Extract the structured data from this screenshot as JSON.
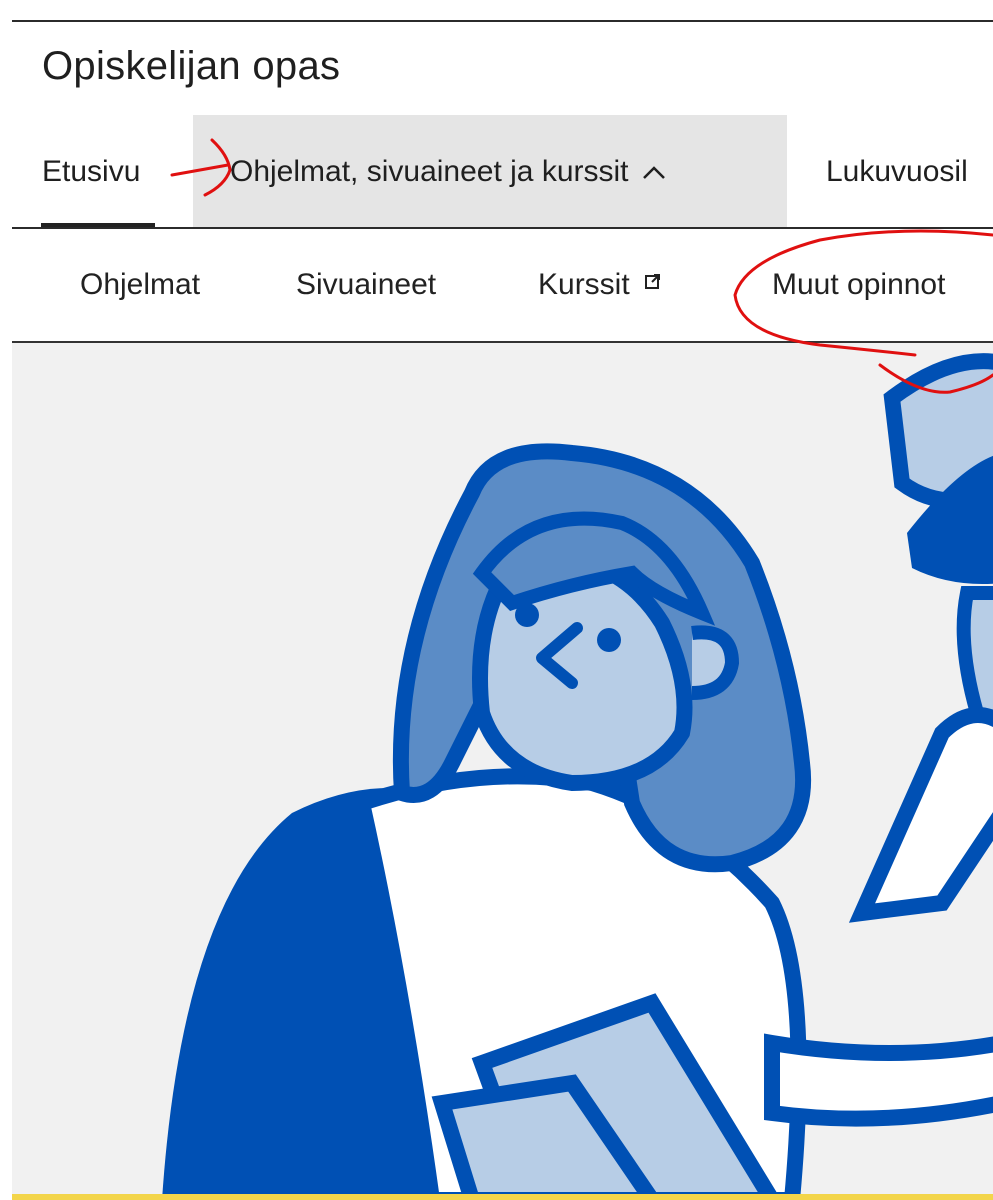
{
  "site": {
    "title": "Opiskelijan opas"
  },
  "primary_nav": {
    "home": "Etusivu",
    "programs": "Ohjelmat, sivuaineet ja kurssit",
    "programs_expanded": true,
    "year": "Lukuvuosil"
  },
  "sub_nav": {
    "programs": "Ohjelmat",
    "minors": "Sivuaineet",
    "courses": "Kurssit",
    "other": "Muut opinnot"
  },
  "icons": {
    "chevron": "chevron-up-icon",
    "external": "external-link-icon"
  },
  "colors": {
    "brand_blue": "#0050b4",
    "light_blue": "#b7cde6",
    "mid_blue": "#5b8cc6",
    "annotation_red": "#e01010",
    "active_tab_bg": "#e5e5e5",
    "accent_yellow": "#f3d54a"
  }
}
